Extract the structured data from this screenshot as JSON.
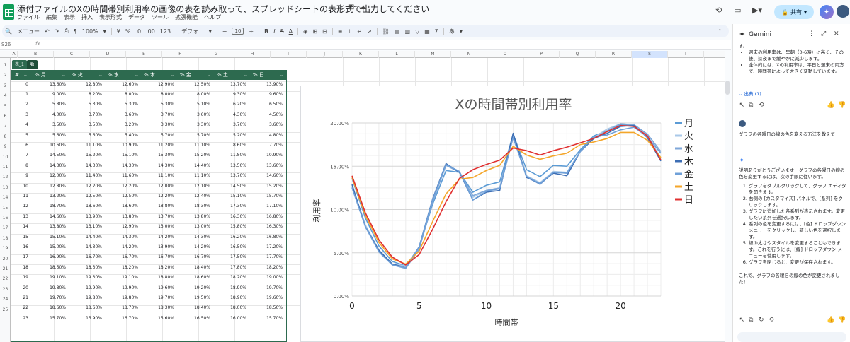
{
  "header": {
    "title": "添付ファイルのXの時間帯別利用率の画像の表を読み取って、スプレッドシートの表形式で出力してください",
    "menu": [
      "ファイル",
      "編集",
      "表示",
      "挿入",
      "表示形式",
      "データ",
      "ツール",
      "拡張機能",
      "ヘルプ"
    ],
    "share_label": "共有"
  },
  "toolbar": {
    "menu_search": "メニュー",
    "zoom": "100%",
    "currency": "¥",
    "percent": "%",
    "dec_dec": ".0",
    "dec_inc": ".00",
    "number_fmt": "123",
    "font": "デフォ...",
    "font_size": "10"
  },
  "formula_bar": {
    "name_box": "S26",
    "fx": "fx"
  },
  "grid": {
    "columns": [
      "A",
      "B",
      "C",
      "D",
      "E",
      "F",
      "G",
      "H",
      "I",
      "J",
      "K",
      "L",
      "M",
      "N",
      "O",
      "P",
      "Q",
      "R",
      "S",
      "T"
    ],
    "rows": [
      "1",
      "2",
      "3",
      "4",
      "5",
      "6",
      "7",
      "8",
      "9",
      "10",
      "11",
      "12",
      "13",
      "14",
      "15",
      "16",
      "17",
      "18",
      "19",
      "20",
      "21",
      "22",
      "23",
      "24",
      "25"
    ]
  },
  "table": {
    "tag": "表_1",
    "headers": [
      "#",
      "% 月",
      "% 火",
      "% 水",
      "% 木",
      "% 金",
      "% 土",
      "% 日"
    ],
    "rows": [
      [
        "0",
        "13.60%",
        "12.80%",
        "12.60%",
        "12.90%",
        "12.50%",
        "13.70%",
        "13.90%"
      ],
      [
        "1",
        "9.00%",
        "8.20%",
        "8.00%",
        "8.00%",
        "8.00%",
        "9.30%",
        "9.60%"
      ],
      [
        "2",
        "5.80%",
        "5.30%",
        "5.30%",
        "5.30%",
        "5.10%",
        "6.20%",
        "6.50%"
      ],
      [
        "3",
        "4.00%",
        "3.70%",
        "3.60%",
        "3.70%",
        "3.60%",
        "4.30%",
        "4.50%"
      ],
      [
        "4",
        "3.50%",
        "3.50%",
        "3.20%",
        "3.30%",
        "3.30%",
        "3.70%",
        "3.60%"
      ],
      [
        "5",
        "5.60%",
        "5.60%",
        "5.40%",
        "5.70%",
        "5.70%",
        "5.20%",
        "4.80%"
      ],
      [
        "6",
        "10.60%",
        "11.10%",
        "10.90%",
        "11.20%",
        "11.10%",
        "8.60%",
        "7.70%"
      ],
      [
        "7",
        "14.50%",
        "15.20%",
        "15.10%",
        "15.30%",
        "15.20%",
        "11.80%",
        "10.90%"
      ],
      [
        "8",
        "14.30%",
        "14.30%",
        "14.30%",
        "14.30%",
        "14.40%",
        "13.50%",
        "13.60%"
      ],
      [
        "9",
        "12.00%",
        "11.40%",
        "11.60%",
        "11.10%",
        "11.10%",
        "13.70%",
        "14.60%"
      ],
      [
        "10",
        "12.80%",
        "12.20%",
        "12.20%",
        "12.00%",
        "12.10%",
        "14.50%",
        "15.20%"
      ],
      [
        "11",
        "13.20%",
        "12.50%",
        "12.50%",
        "12.20%",
        "12.40%",
        "15.10%",
        "15.70%"
      ],
      [
        "12",
        "18.70%",
        "18.60%",
        "18.60%",
        "18.80%",
        "18.30%",
        "17.30%",
        "17.10%"
      ],
      [
        "13",
        "14.60%",
        "13.90%",
        "13.80%",
        "13.70%",
        "13.80%",
        "16.30%",
        "16.80%"
      ],
      [
        "14",
        "13.80%",
        "13.10%",
        "12.90%",
        "13.00%",
        "13.00%",
        "15.80%",
        "16.30%"
      ],
      [
        "15",
        "15.10%",
        "14.40%",
        "14.30%",
        "14.20%",
        "14.30%",
        "16.20%",
        "16.80%"
      ],
      [
        "16",
        "15.00%",
        "14.30%",
        "14.20%",
        "13.90%",
        "14.20%",
        "16.50%",
        "17.20%"
      ],
      [
        "17",
        "16.90%",
        "16.70%",
        "16.70%",
        "16.70%",
        "16.70%",
        "17.50%",
        "17.70%"
      ],
      [
        "18",
        "18.50%",
        "18.30%",
        "18.20%",
        "18.20%",
        "18.40%",
        "17.80%",
        "18.20%"
      ],
      [
        "19",
        "19.10%",
        "19.30%",
        "19.10%",
        "18.80%",
        "18.60%",
        "18.20%",
        "19.00%"
      ],
      [
        "20",
        "19.80%",
        "19.90%",
        "19.90%",
        "19.60%",
        "19.20%",
        "18.90%",
        "19.70%"
      ],
      [
        "21",
        "19.70%",
        "19.80%",
        "19.80%",
        "19.70%",
        "19.50%",
        "18.90%",
        "19.60%"
      ],
      [
        "22",
        "18.60%",
        "18.60%",
        "18.70%",
        "18.30%",
        "18.40%",
        "18.00%",
        "18.50%"
      ],
      [
        "23",
        "15.70%",
        "15.90%",
        "16.70%",
        "15.60%",
        "16.50%",
        "16.00%",
        "15.70%"
      ]
    ]
  },
  "chart_data": {
    "type": "line",
    "title": "Xの時間帯別利用率",
    "xlabel": "時間帯",
    "ylabel": "利用率",
    "xlim": [
      0,
      23
    ],
    "ylim": [
      0,
      20
    ],
    "x_ticks": [
      "0",
      "5",
      "10",
      "15",
      "20"
    ],
    "y_ticks": [
      "0.00%",
      "5.00%",
      "10.00%",
      "15.00%",
      "20.00%"
    ],
    "legend_position": "right",
    "x": [
      0,
      1,
      2,
      3,
      4,
      5,
      6,
      7,
      8,
      9,
      10,
      11,
      12,
      13,
      14,
      15,
      16,
      17,
      18,
      19,
      20,
      21,
      22,
      23
    ],
    "series": [
      {
        "name": "月",
        "color": "#5b9bd5",
        "values": [
          13.6,
          9.0,
          5.8,
          4.0,
          3.5,
          5.6,
          10.6,
          14.5,
          14.3,
          12.0,
          12.8,
          13.2,
          18.7,
          14.6,
          13.8,
          15.1,
          15.0,
          16.9,
          18.5,
          19.1,
          19.8,
          19.7,
          18.6,
          15.7
        ]
      },
      {
        "name": "火",
        "color": "#a9c8e8",
        "values": [
          12.8,
          8.2,
          5.3,
          3.7,
          3.5,
          5.6,
          11.1,
          15.2,
          14.3,
          11.4,
          12.2,
          12.5,
          18.6,
          13.9,
          13.1,
          14.4,
          14.3,
          16.7,
          18.3,
          19.3,
          19.9,
          19.8,
          18.6,
          15.9
        ]
      },
      {
        "name": "水",
        "color": "#7fa7d9",
        "values": [
          12.6,
          8.0,
          5.3,
          3.6,
          3.2,
          5.4,
          10.9,
          15.1,
          14.3,
          11.6,
          12.2,
          12.5,
          18.6,
          13.8,
          12.9,
          14.3,
          14.2,
          16.7,
          18.2,
          19.1,
          19.9,
          19.8,
          18.7,
          16.7
        ]
      },
      {
        "name": "木",
        "color": "#3d6eb4",
        "values": [
          12.9,
          8.0,
          5.3,
          3.7,
          3.3,
          5.7,
          11.2,
          15.3,
          14.3,
          11.1,
          12.0,
          12.2,
          18.8,
          13.7,
          13.0,
          14.2,
          13.9,
          16.7,
          18.2,
          18.8,
          19.6,
          19.7,
          18.3,
          15.6
        ]
      },
      {
        "name": "金",
        "color": "#6fa0d8",
        "values": [
          12.5,
          8.0,
          5.1,
          3.6,
          3.3,
          5.7,
          11.1,
          15.2,
          14.4,
          11.1,
          12.1,
          12.4,
          18.3,
          13.8,
          13.0,
          14.3,
          14.2,
          16.7,
          18.4,
          18.6,
          19.2,
          19.5,
          18.4,
          16.5
        ]
      },
      {
        "name": "土",
        "color": "#f4a62a",
        "values": [
          13.7,
          9.3,
          6.2,
          4.3,
          3.7,
          5.2,
          8.6,
          11.8,
          13.5,
          13.7,
          14.5,
          15.1,
          17.3,
          16.3,
          15.8,
          16.2,
          16.5,
          17.5,
          17.8,
          18.2,
          18.9,
          18.9,
          18.0,
          16.0
        ]
      },
      {
        "name": "日",
        "color": "#e03030",
        "values": [
          13.9,
          9.6,
          6.5,
          4.5,
          3.6,
          4.8,
          7.7,
          10.9,
          13.6,
          14.6,
          15.2,
          15.7,
          17.1,
          16.8,
          16.3,
          16.8,
          17.2,
          17.7,
          18.2,
          19.0,
          19.7,
          19.6,
          18.5,
          15.7
        ]
      }
    ]
  },
  "gemini": {
    "title": "Gemini",
    "prev_text": "す。",
    "bullets": [
      "週末の利用率は、早朝（0-6時）に高く、その後、深夜まで緩やかに減少します。",
      "全体的には、Xの利用率は、平日と週末の両方で、時間帯によって大きく変動しています。"
    ],
    "sources": "出典 (1)",
    "user_question": "グラフの各曜日の線の色を変える方法を教えて",
    "answer_intro": "説明ありがとうございます！グラフの各曜日の線の色を変更するには、次の手順に従います。",
    "steps": [
      "グラフをダブルクリックして、グラフ エディタを開きます。",
      "右側の [カスタマイズ] パネルで、[系列] をクリックします。",
      "グラフに追加した各系列が表示されます。変更したい系列を選択します。",
      "系列の色を変更するには、[色] ドロップダウン メニューをクリックし、新しい色を選択します。",
      "線の太さやスタイルを変更することもできます。これを行うには、[線] ドロップダウン メニューを使用します。",
      "グラフを閉じると、変更が保存されます。"
    ],
    "answer_outro": "これで、グラフの各曜日の線の色が変更されました！"
  }
}
